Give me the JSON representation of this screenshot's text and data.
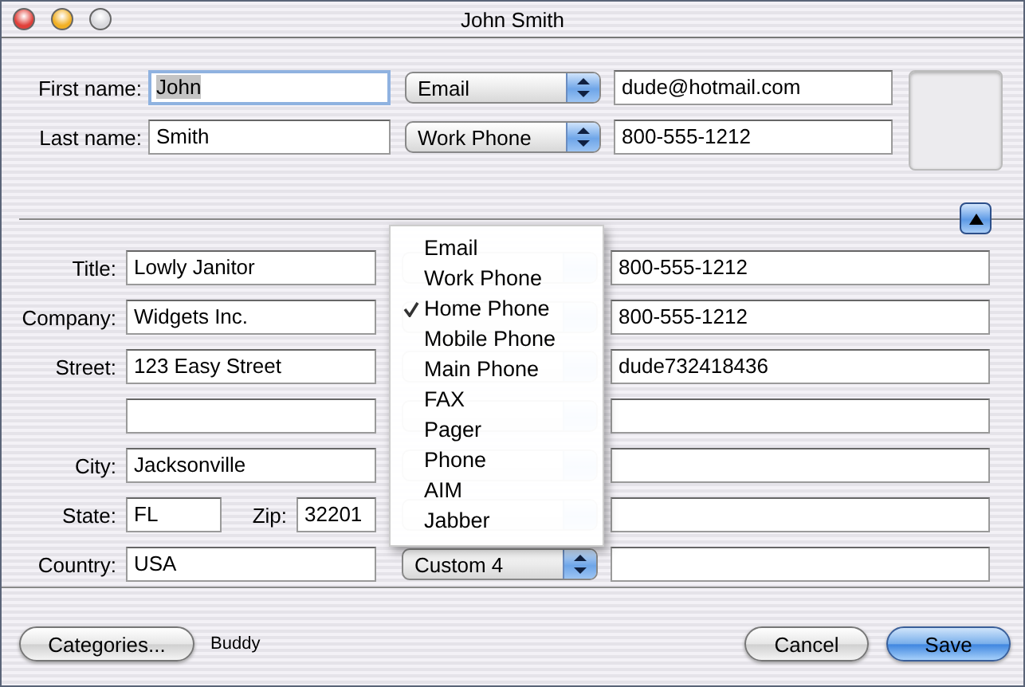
{
  "window": {
    "title": "John Smith"
  },
  "name_fields": [
    {
      "label": "First name:",
      "value": "John",
      "focused": true
    },
    {
      "label": "Last name:",
      "value": "Smith",
      "focused": false
    }
  ],
  "top_contacts": [
    {
      "popup_label": "Email",
      "value": "dude@hotmail.com"
    },
    {
      "popup_label": "Work Phone",
      "value": "800-555-1212"
    }
  ],
  "address_fields": [
    {
      "kind": "single",
      "label": "Title:",
      "value": "Lowly Janitor"
    },
    {
      "kind": "single",
      "label": "Company:",
      "value": "Widgets Inc."
    },
    {
      "kind": "single",
      "label": "Street:",
      "value": "123 Easy Street"
    },
    {
      "kind": "single"
    },
    {
      "kind": "single",
      "label": "City:",
      "value": "Jacksonville"
    },
    {
      "kind": "pair",
      "label": "State:",
      "value": "FL",
      "label_2": "Zip:",
      "value_2": "32201"
    },
    {
      "kind": "single",
      "label": "Country:",
      "value": "USA"
    }
  ],
  "contact_fields": [
    {
      "kind": "covered",
      "value": "800-555-1212"
    },
    {
      "kind": "covered",
      "value": "800-555-1212"
    },
    {
      "kind": "covered",
      "value": "dude732418436"
    },
    {
      "kind": "covered"
    },
    {
      "kind": "covered"
    },
    {
      "kind": "covered"
    },
    {
      "kind": "labeled",
      "popup_label": "Custom 4"
    }
  ],
  "popup_menu": {
    "items": [
      {
        "label": "Email",
        "selected": false
      },
      {
        "label": "Work Phone",
        "selected": false
      },
      {
        "label": "Home Phone",
        "selected": true
      },
      {
        "label": "Mobile Phone",
        "selected": false
      },
      {
        "label": "Main Phone",
        "selected": false
      },
      {
        "label": "FAX",
        "selected": false
      },
      {
        "label": "Pager",
        "selected": false
      },
      {
        "label": "Phone",
        "selected": false
      },
      {
        "label": "AIM",
        "selected": false
      },
      {
        "label": "Jabber",
        "selected": false
      }
    ]
  },
  "footer": {
    "categories_button": "Categories...",
    "group_label": "Buddy",
    "buttons": [
      {
        "kind": "cancel",
        "label": "Cancel"
      },
      {
        "kind": "default",
        "label": "Save"
      }
    ]
  }
}
